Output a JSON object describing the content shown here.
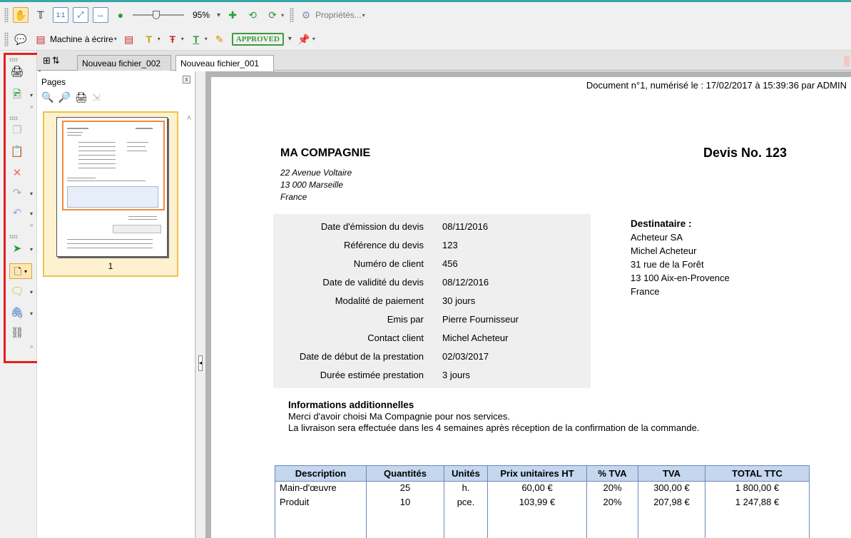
{
  "toolbar1": {
    "zoom_value": "95%",
    "properties_label": "Propriétés..."
  },
  "toolbar2": {
    "typewriter_label": "Machine à écrire",
    "stamp_label": "APPROVED"
  },
  "tabs": [
    {
      "label": "Nouveau fichier_002",
      "active": false
    },
    {
      "label": "Nouveau fichier_001",
      "active": true
    }
  ],
  "pages_panel": {
    "title": "Pages",
    "close_glyph": "x",
    "page_number": "1"
  },
  "document": {
    "scan_info": "Document n°1, numérisé le : 17/02/2017 à 15:39:36 par ADMIN",
    "company_name": "MA COMPAGNIE",
    "quote_title": "Devis No. 123",
    "address_lines": [
      "22 Avenue Voltaire",
      "13 000 Marseille",
      "France"
    ],
    "info_rows": [
      {
        "label": "Date d'émission du devis",
        "value": "08/11/2016"
      },
      {
        "label": "Référence du devis",
        "value": "123"
      },
      {
        "label": "Numéro de client",
        "value": "456"
      },
      {
        "label": "Date de validité du devis",
        "value": "08/12/2016"
      },
      {
        "label": "Modalité de paiement",
        "value": "30 jours"
      },
      {
        "label": "Emis par",
        "value": "Pierre Fournisseur"
      },
      {
        "label": "Contact client",
        "value": "Michel Acheteur"
      },
      {
        "label": "Date de début de la prestation",
        "value": "02/03/2017"
      },
      {
        "label": "Durée estimée prestation",
        "value": "3 jours"
      }
    ],
    "recipient": {
      "title": "Destinataire :",
      "lines": [
        "Acheteur SA",
        "Michel Acheteur",
        "31 rue de la Forêt",
        "13 100 Aix-en-Provence",
        "France"
      ]
    },
    "additional": {
      "title": "Informations additionnelles",
      "line1": "Merci d'avoir choisi Ma Compagnie pour nos services.",
      "line2": "La livraison sera effectuée dans les 4 semaines après réception de la confirmation de la commande."
    },
    "table": {
      "headers": [
        "Description",
        "Quantités",
        "Unités",
        "Prix unitaires HT",
        "% TVA",
        "TVA",
        "TOTAL TTC"
      ],
      "rows": [
        [
          "Main-d'œuvre",
          "25",
          "h.",
          "60,00 €",
          "20%",
          "300,00 €",
          "1 800,00 €"
        ],
        [
          "Produit",
          "10",
          "pce.",
          "103,99 €",
          "20%",
          "207,98 €",
          "1 247,88 €"
        ]
      ]
    }
  },
  "colors": {
    "highlight_red": "#e41e1e",
    "table_header": "#c5d6ef",
    "selection": "#f0c14b"
  }
}
